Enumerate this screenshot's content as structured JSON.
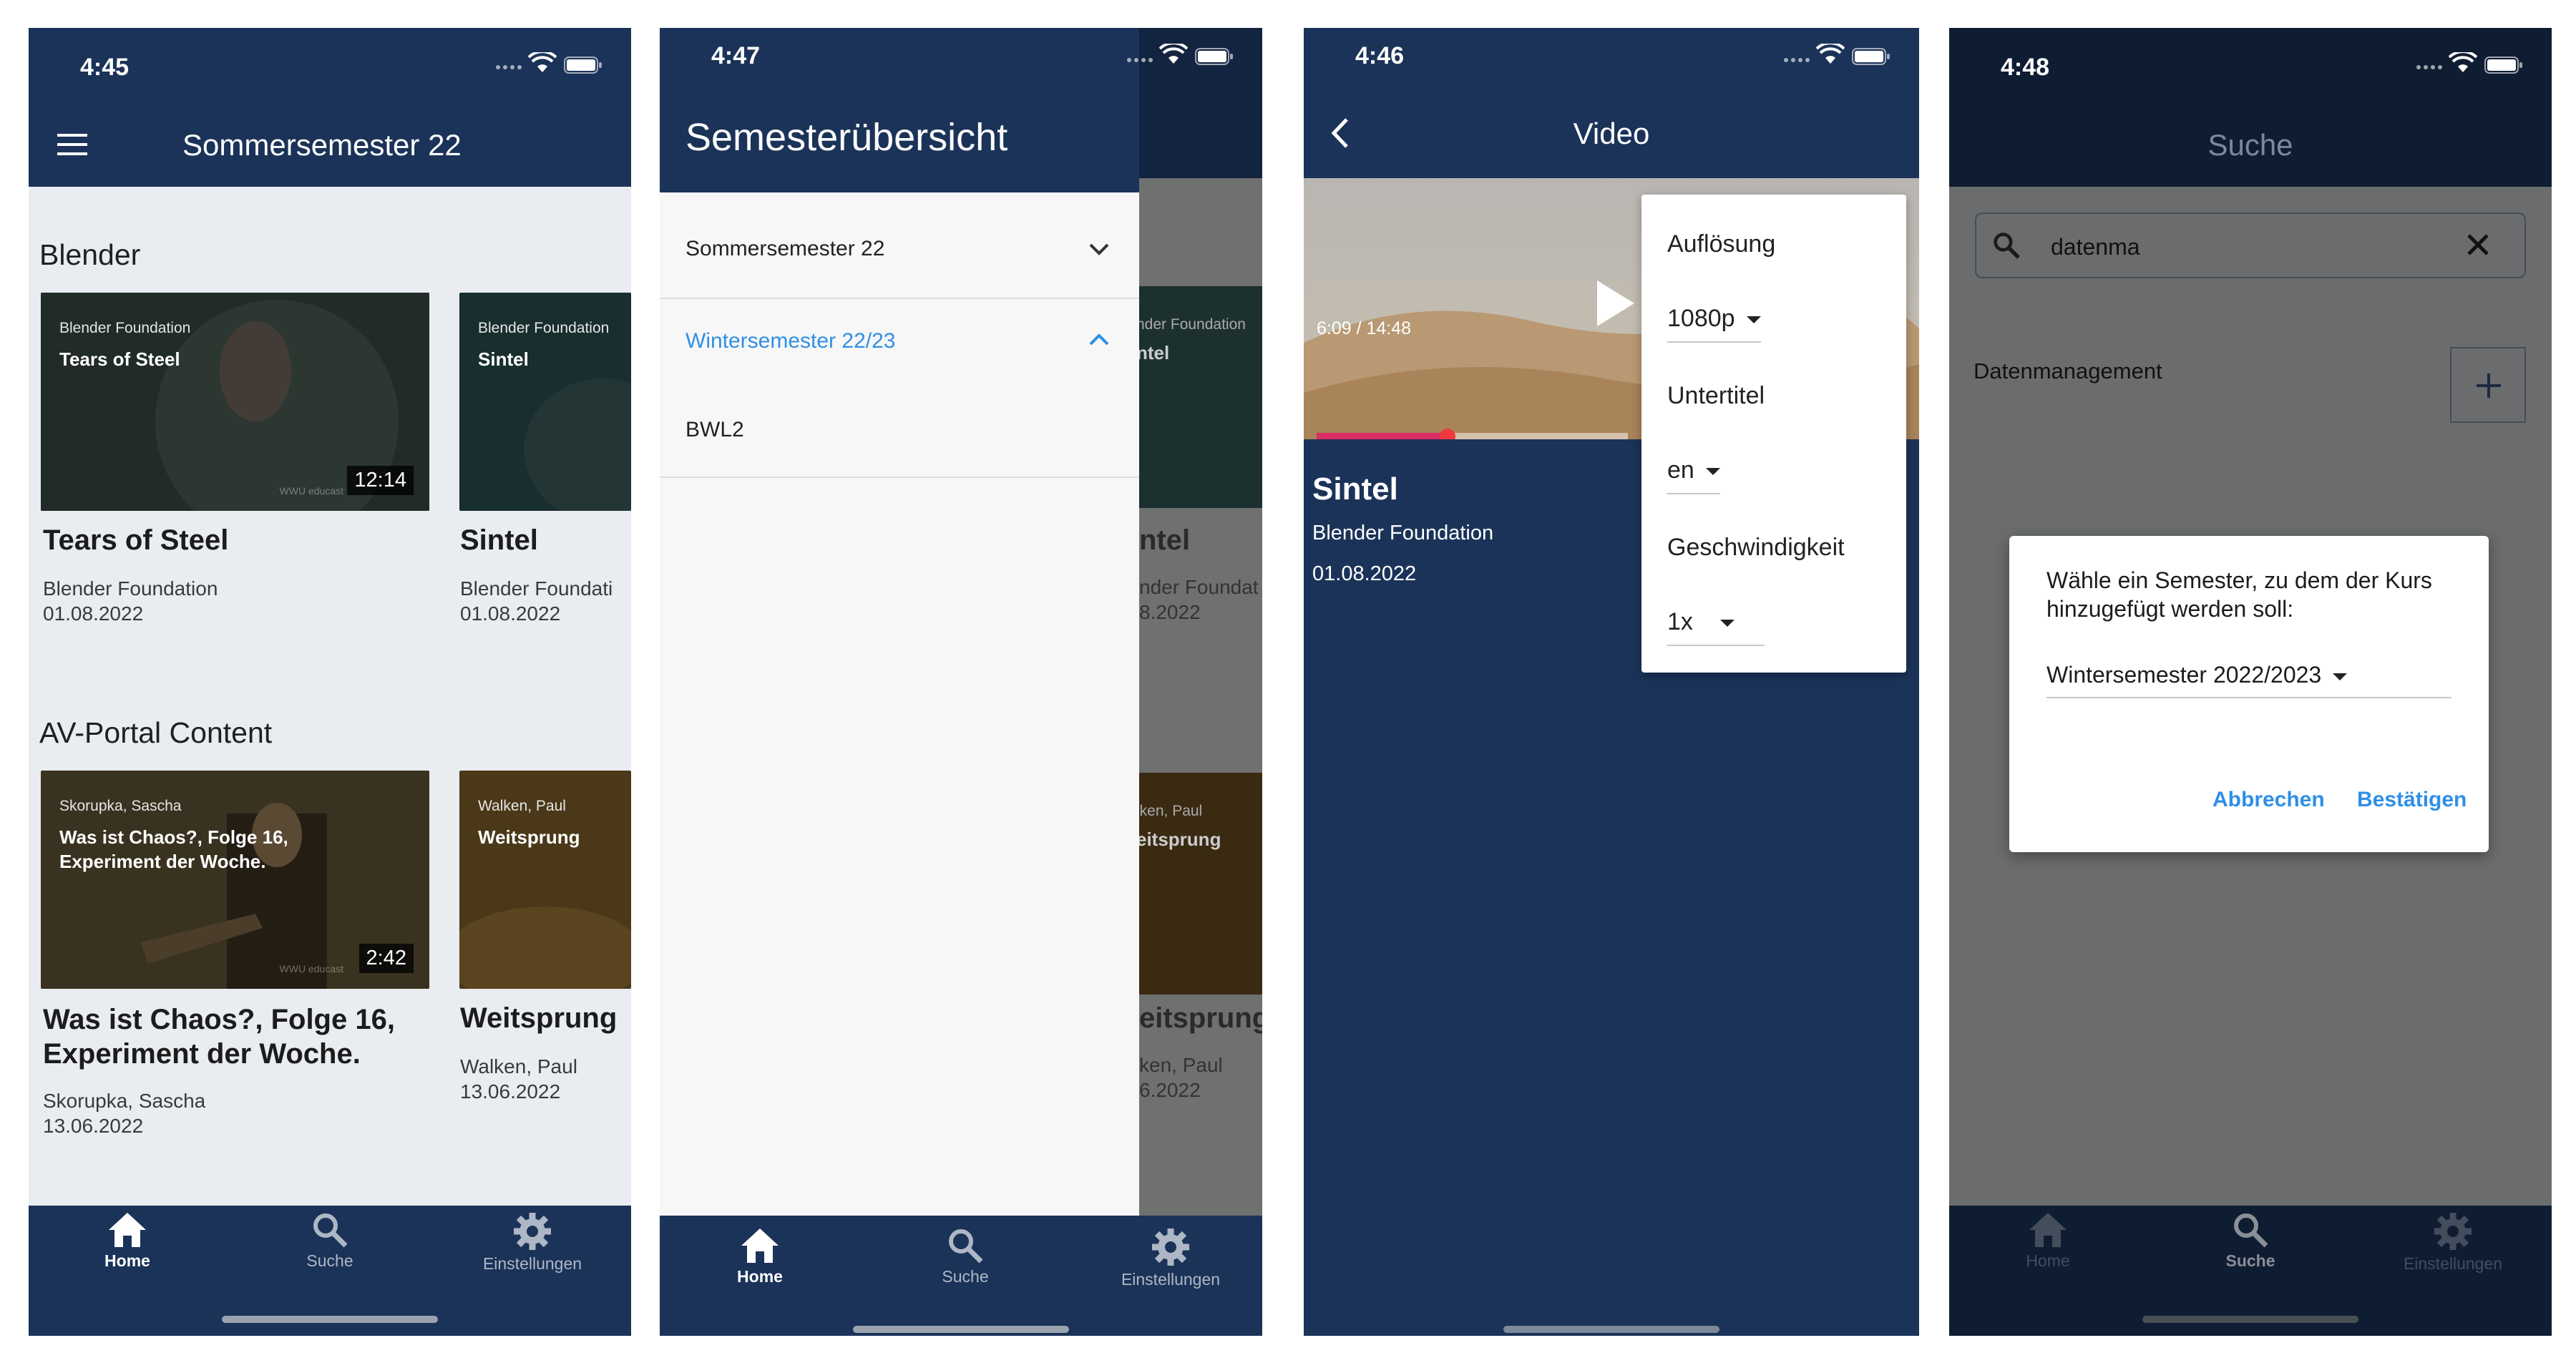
{
  "screens": {
    "home": {
      "time": "4:45",
      "title": "Sommersemester 22",
      "sections": [
        {
          "title": "Blender",
          "cards": [
            {
              "thumb_author": "Blender Foundation",
              "thumb_title": "Tears of Steel",
              "duration": "12:14",
              "title": "Tears of Steel",
              "author": "Blender Foundation",
              "date": "01.08.2022"
            },
            {
              "thumb_author": "Blender Foundation",
              "thumb_title": "Sintel",
              "duration": "",
              "title": "Sintel",
              "author": "Blender Foundati",
              "date": "01.08.2022"
            }
          ]
        },
        {
          "title": "AV-Portal Content",
          "cards": [
            {
              "thumb_author": "Skorupka, Sascha",
              "thumb_title": "Was ist Chaos?, Folge 16,\nExperiment der Woche.",
              "duration": "2:42",
              "title": "Was ist Chaos?, Folge 16,\nExperiment der Woche.",
              "author": "Skorupka, Sascha",
              "date": "13.06.2022"
            },
            {
              "thumb_author": "Walken, Paul",
              "thumb_title": "Weitsprung",
              "duration": "",
              "title": "Weitsprunɡ",
              "author": "Walken, Paul",
              "date": "13.06.2022"
            }
          ]
        }
      ],
      "watermark": "WWU educast"
    },
    "drawer": {
      "time": "4:47",
      "title": "Semesterübersicht",
      "items": [
        {
          "label": "Sommersemester 22",
          "expanded": false
        },
        {
          "label": "Wintersemester 22/23",
          "expanded": true
        }
      ],
      "sub_item": "BWL2",
      "bg_cards": [
        {
          "author": "nder Foundation",
          "thumb_title": "ntel",
          "title": "ntel",
          "sub": "nder Foundat",
          "date": "8.2022"
        },
        {
          "author": "lken, Paul",
          "thumb_title": "eitsprung",
          "title": "eitsprunɡ",
          "sub": "ken, Paul",
          "date": "6.2022"
        }
      ]
    },
    "video": {
      "time": "4:46",
      "title": "Video",
      "time_display": "6:09 / 14:48",
      "progress": 0.42,
      "video_title": "Sintel",
      "author": "Blender Foundation",
      "date": "01.08.2022",
      "menu": {
        "resolution_label": "Auflösung",
        "resolution_value": "1080p",
        "subtitle_label": "Untertitel",
        "subtitle_value": "en",
        "speed_label": "Geschwindigkeit",
        "speed_value": "1x"
      }
    },
    "search": {
      "time": "4:48",
      "title": "Suche",
      "query": "datenma",
      "result": "Datenmanagement",
      "dialog": {
        "message": "Wähle ein Semester, zu dem der Kurs hinzugefügt werden soll:",
        "selected": "Wintersemester 2022/2023",
        "cancel": "Abbrechen",
        "confirm": "Bestätigen"
      }
    }
  },
  "tabs": [
    "Home",
    "Suche",
    "Einstellungen"
  ],
  "colors": {
    "navy": "#1b3358",
    "accent": "#2f8fe6",
    "progress": "#d92d64"
  }
}
